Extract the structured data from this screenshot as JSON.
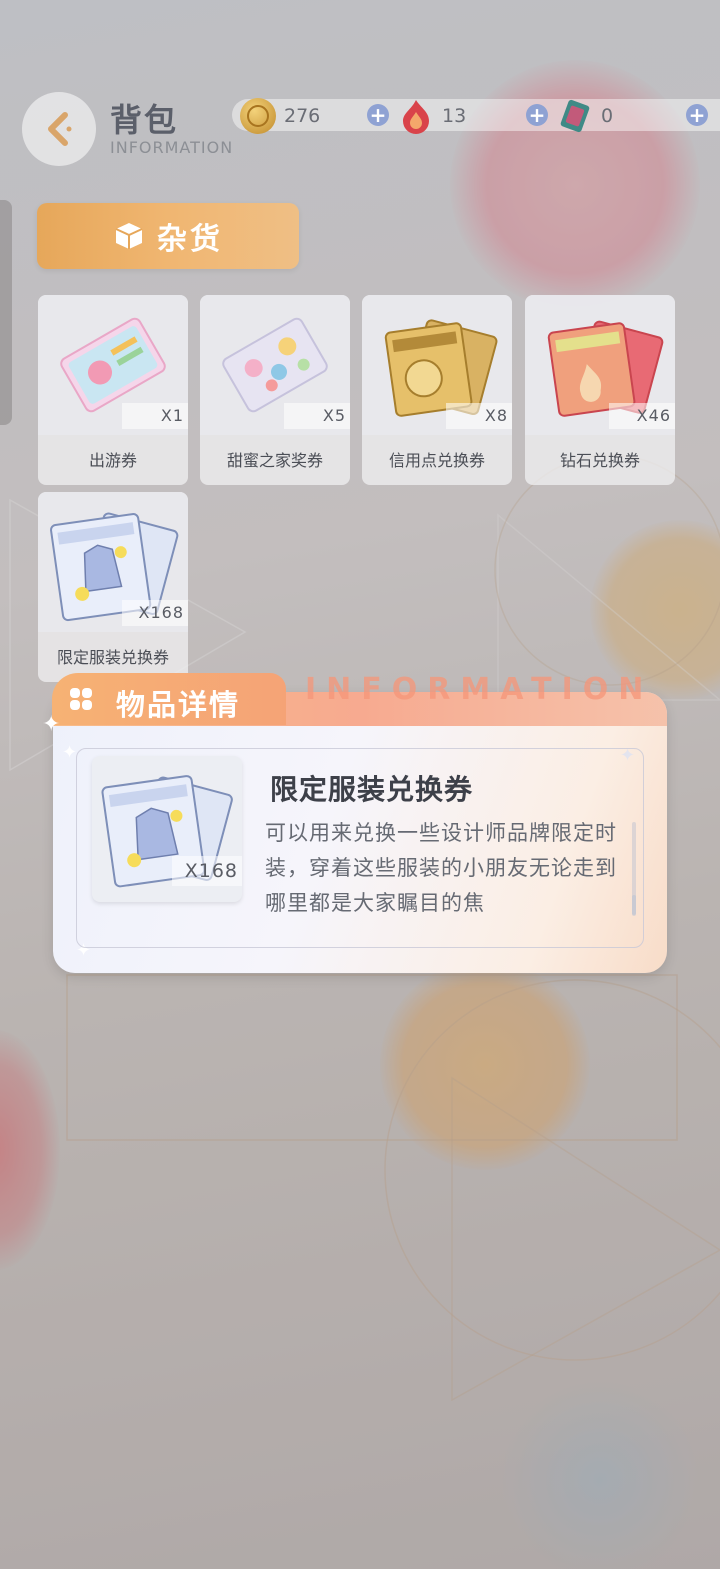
{
  "header": {
    "title": "背包",
    "subtitle": "INFORMATION"
  },
  "currencies": [
    {
      "icon": "gold-coin-icon",
      "value": "276"
    },
    {
      "icon": "flame-gem-icon",
      "value": "13"
    },
    {
      "icon": "diamond-card-icon",
      "value": "0"
    }
  ],
  "category_tab": {
    "label": "杂货",
    "icon": "box-icon"
  },
  "items": [
    {
      "name": "出游券",
      "count": "X1",
      "icon": "travel-ticket-icon"
    },
    {
      "name": "甜蜜之家奖券",
      "count": "X5",
      "icon": "sweet-home-ticket-icon"
    },
    {
      "name": "信用点兑换券",
      "count": "X8",
      "icon": "credit-exchange-ticket-icon"
    },
    {
      "name": "钻石兑换券",
      "count": "X46",
      "icon": "diamond-exchange-ticket-icon"
    },
    {
      "name": "限定服装兑换券",
      "count": "X168",
      "icon": "outfit-exchange-ticket-icon"
    }
  ],
  "detail": {
    "header_title": "物品详情",
    "watermark": "INFORMATION",
    "item_name": "限定服装兑换券",
    "item_count": "X168",
    "description": "可以用来兑换一些设计师品牌限定时装，穿着这些服装的小朋友无论走到哪里都是大家瞩目的焦"
  },
  "colors": {
    "accent_orange": "#f0b671",
    "plus_button": "#8fa2d3",
    "detail_header": "#f6b274"
  }
}
